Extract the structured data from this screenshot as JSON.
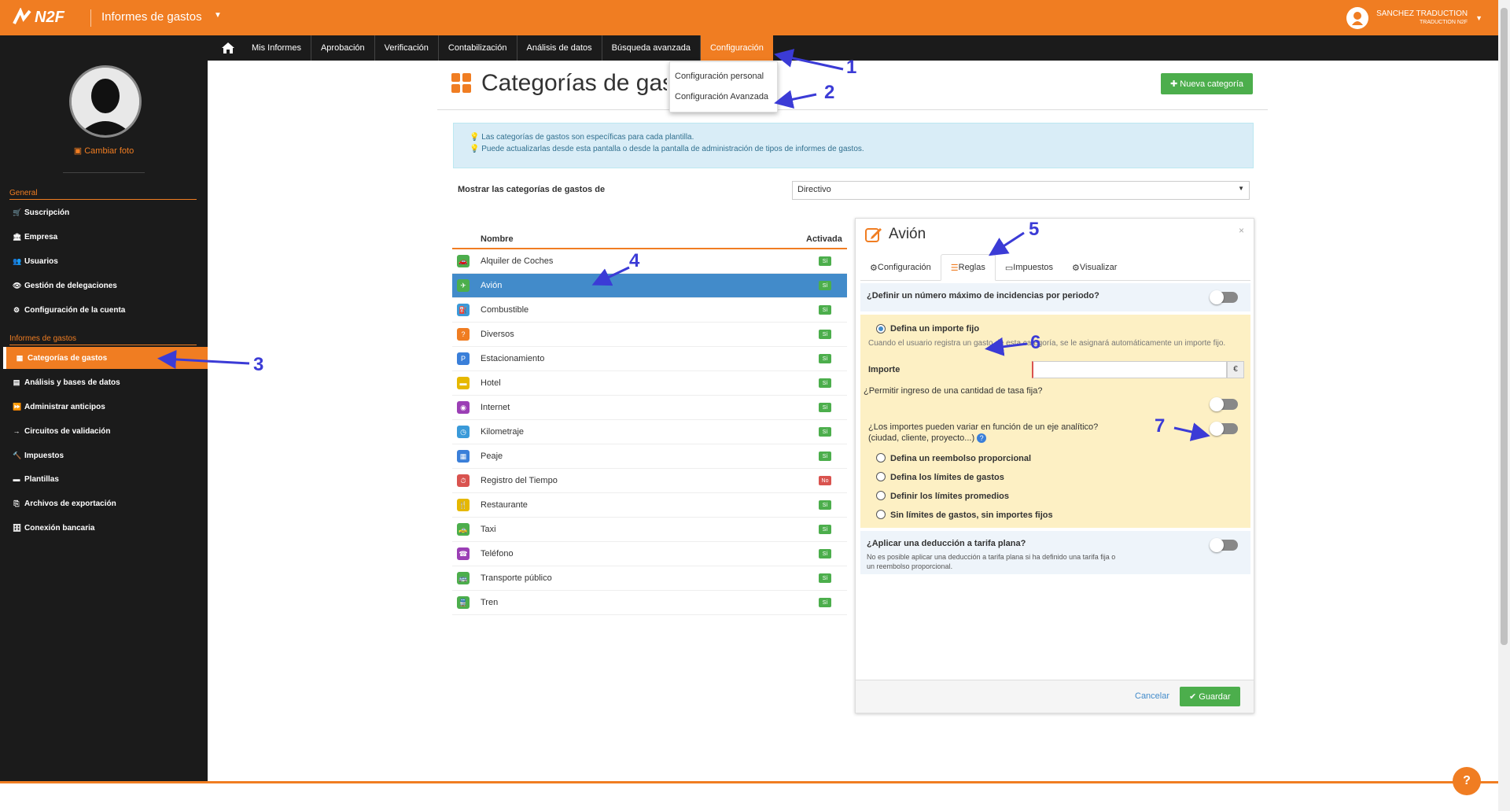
{
  "app": {
    "brand": "N2F",
    "title": "Informes de gastos"
  },
  "user": {
    "name": "SANCHEZ TRADUCTION",
    "company": "TRADUCTION N2F"
  },
  "nav": {
    "items": [
      "Mis Informes",
      "Aprobación",
      "Verificación",
      "Contabilización",
      "Análisis de datos",
      "Búsqueda avanzada",
      "Configuración"
    ]
  },
  "dropdown": {
    "items": [
      "Configuración personal",
      "Configuración Avanzada"
    ]
  },
  "sidebar": {
    "change_photo": "Cambiar foto",
    "general_header": "General",
    "general": [
      {
        "label": "Suscripción",
        "icon": "cart-icon"
      },
      {
        "label": "Empresa",
        "icon": "bank-icon"
      },
      {
        "label": "Usuarios",
        "icon": "users-icon"
      },
      {
        "label": "Gestión de delegaciones",
        "icon": "eye-icon"
      },
      {
        "label": "Configuración de la cuenta",
        "icon": "gears-icon"
      }
    ],
    "reports_header": "Informes de gastos",
    "reports": [
      {
        "label": "Categorías de gastos",
        "icon": "grid-icon"
      },
      {
        "label": "Análisis y bases de datos",
        "icon": "table-icon"
      },
      {
        "label": "Administrar anticipos",
        "icon": "forward-icon"
      },
      {
        "label": "Circuitos de validación",
        "icon": "arrow-icon"
      },
      {
        "label": "Impuestos",
        "icon": "gavel-icon"
      },
      {
        "label": "Plantillas",
        "icon": "template-icon"
      },
      {
        "label": "Archivos de exportación",
        "icon": "export-icon"
      },
      {
        "label": "Conexión bancaria",
        "icon": "bank-conn-icon"
      }
    ]
  },
  "page": {
    "title": "Categorías de gastos",
    "new_button": "Nueva categoría",
    "info": [
      "Las categorías de gastos son específicas para cada plantilla.",
      "Puede actualizarlas desde esta pantalla o desde la pantalla de administración de tipos de informes de gastos."
    ],
    "filter_label": "Mostrar las categorías de gastos de",
    "filter_value": "Directivo"
  },
  "table": {
    "col_name": "Nombre",
    "col_active": "Activada",
    "rows": [
      {
        "name": "Alquiler de Coches",
        "active": "Sí",
        "color": "#4cae4c",
        "glyph": "🚗"
      },
      {
        "name": "Avión",
        "active": "Sí",
        "color": "#4cae4c",
        "glyph": "✈"
      },
      {
        "name": "Combustible",
        "active": "Sí",
        "color": "#3a9ad9",
        "glyph": "⛽"
      },
      {
        "name": "Diversos",
        "active": "Sí",
        "color": "#f07d22",
        "glyph": "?"
      },
      {
        "name": "Estacionamiento",
        "active": "Sí",
        "color": "#3a7fd9",
        "glyph": "P"
      },
      {
        "name": "Hotel",
        "active": "Sí",
        "color": "#e6b800",
        "glyph": "▬"
      },
      {
        "name": "Internet",
        "active": "Sí",
        "color": "#9b3fb5",
        "glyph": "◉"
      },
      {
        "name": "Kilometraje",
        "active": "Sí",
        "color": "#3a9ad9",
        "glyph": "◷"
      },
      {
        "name": "Peaje",
        "active": "Sí",
        "color": "#3a7fd9",
        "glyph": "▦"
      },
      {
        "name": "Registro del Tiempo",
        "active": "No",
        "color": "#d9534f",
        "glyph": "⏱"
      },
      {
        "name": "Restaurante",
        "active": "Sí",
        "color": "#e6b800",
        "glyph": "🍴"
      },
      {
        "name": "Taxi",
        "active": "Sí",
        "color": "#4cae4c",
        "glyph": "🚕"
      },
      {
        "name": "Teléfono",
        "active": "Sí",
        "color": "#9b3fb5",
        "glyph": "☎"
      },
      {
        "name": "Transporte público",
        "active": "Sí",
        "color": "#4cae4c",
        "glyph": "🚌"
      },
      {
        "name": "Tren",
        "active": "Sí",
        "color": "#4cae4c",
        "glyph": "🚆"
      }
    ]
  },
  "panel": {
    "title": "Avión",
    "close": "×",
    "tabs": [
      "Configuración",
      "Reglas",
      "Impuestos",
      "Visualizar"
    ],
    "q_max": "¿Definir un número máximo de incidencias por periodo?",
    "fixed_label": "Defina un importe fijo",
    "fixed_desc": "Cuando el usuario registra un gasto de esta categoría, se le asignará automáticamente un importe fijo.",
    "amount_label": "Importe",
    "currency": "€",
    "q_rate": "¿Permitir ingreso de una cantidad de tasa fija?",
    "q_axis": "¿Los importes pueden variar en función de un eje analítico?",
    "q_axis2": "(ciudad, cliente, proyecto...)",
    "options": [
      "Defina un reembolso proporcional",
      "Defina los límites de gastos",
      "Definir los límites promedios",
      "Sin límites de gastos, sin importes fijos"
    ],
    "q_flat": "¿Aplicar una deducción a tarifa plana?",
    "flat_note": "No es posible aplicar una deducción a tarifa plana si ha definido una tarifa fija o un reembolso proporcional.",
    "cancel": "Cancelar",
    "save": "Guardar"
  },
  "annotations": [
    "1",
    "2",
    "3",
    "4",
    "5",
    "6",
    "7"
  ],
  "colors": {
    "accent": "#f07d22",
    "dark": "#1b1b1b",
    "green": "#4cae4c",
    "blue": "#428bca",
    "annotation": "#3b3bd6"
  }
}
